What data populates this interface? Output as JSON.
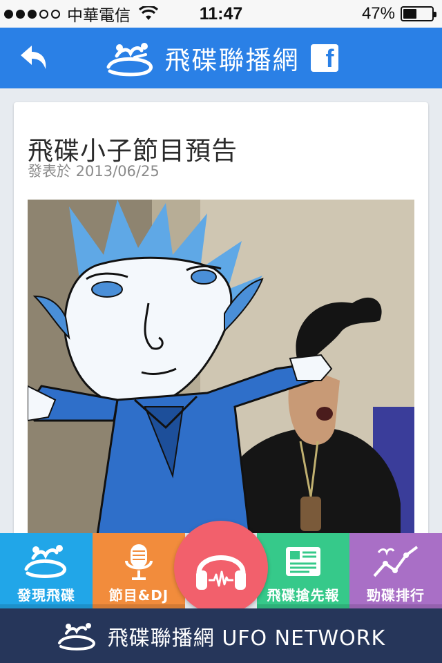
{
  "status_bar": {
    "carrier": "中華電信",
    "time": "11:47",
    "battery_text": "47%",
    "battery_level": 0.47,
    "signal_bars_filled": 3,
    "signal_bars_total": 5
  },
  "nav": {
    "title": "飛碟聯播網",
    "facebook_letter": "f",
    "accent_color": "#2a80e6"
  },
  "post": {
    "title": "飛碟小子節目預告",
    "meta": "發表於 2013/06/25"
  },
  "tabs": [
    {
      "label": "發現飛碟",
      "icon": "ufo-logo-icon",
      "color": "#21a6e8"
    },
    {
      "label": "節目&DJ",
      "icon": "microphone-icon",
      "color": "#f28c3c"
    },
    {
      "label": "飛碟搶先報",
      "icon": "newspaper-icon",
      "color": "#36c98a"
    },
    {
      "label": "勁碟排行",
      "icon": "chart-line-icon",
      "color": "#a96fc6"
    }
  ],
  "play_button": {
    "icon": "headphones-icon",
    "color": "#f2606c"
  },
  "footer": {
    "text": "飛碟聯播網 UFO NETWORK"
  }
}
